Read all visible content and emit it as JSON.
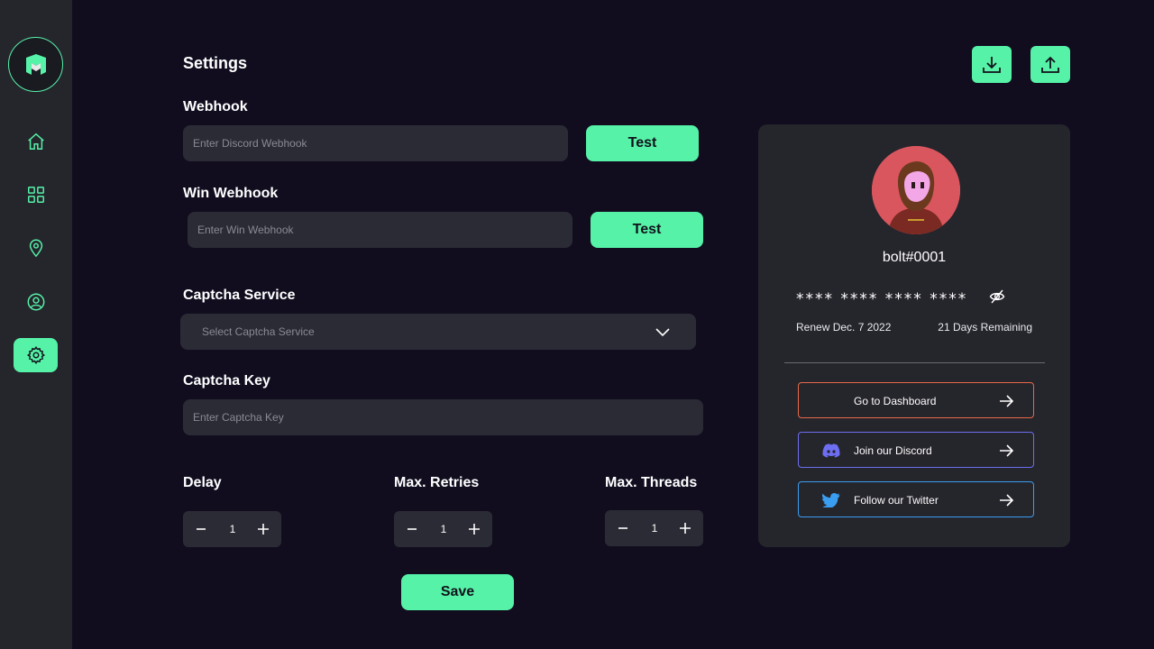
{
  "page": {
    "title": "Settings"
  },
  "webhook": {
    "label": "Webhook",
    "placeholder": "Enter Discord Webhook",
    "test_label": "Test"
  },
  "win_webhook": {
    "label": "Win Webhook",
    "placeholder": "Enter Win Webhook",
    "test_label": "Test"
  },
  "captcha_service": {
    "label": "Captcha Service",
    "placeholder": "Select Captcha Service"
  },
  "captcha_key": {
    "label": "Captcha Key",
    "placeholder": "Enter Captcha Key"
  },
  "delay": {
    "label": "Delay",
    "value": "1"
  },
  "max_retries": {
    "label": "Max. Retries",
    "value": "1"
  },
  "max_threads": {
    "label": "Max. Threads",
    "value": "1"
  },
  "save_label": "Save",
  "profile": {
    "username": "bolt#0001",
    "key": "**** **** **** ****",
    "renew": "Renew Dec. 7 2022",
    "remaining": "21 Days Remaining",
    "links": [
      {
        "label": "Go to Dashboard",
        "border_color": "#e8694a"
      },
      {
        "label": "Join our Discord",
        "border_color": "#6d6ef2"
      },
      {
        "label": "Follow our Twitter",
        "border_color": "#3a9ef0"
      }
    ]
  },
  "icons": {
    "nav": [
      "home-icon",
      "grid-icon",
      "location-pin-icon",
      "user-icon",
      "gear-icon"
    ],
    "toolbar": [
      "download-icon",
      "upload-icon"
    ]
  },
  "colors": {
    "accent": "#56f2a8",
    "background": "#110d1f",
    "panel": "#25252c",
    "input": "#2b2b35"
  }
}
